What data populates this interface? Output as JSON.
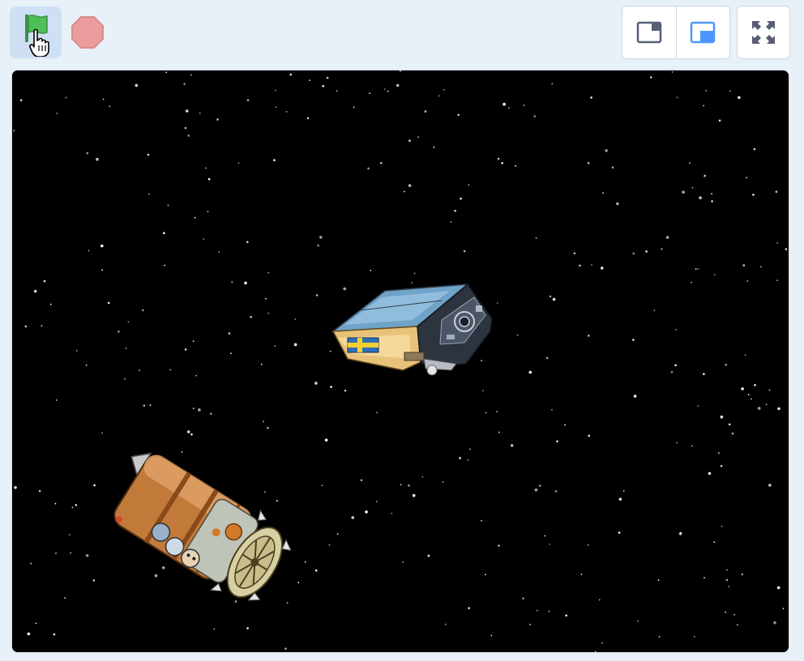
{
  "toolbar": {
    "green_flag": {
      "icon": "green-flag-icon",
      "color": "#4cbf56",
      "state": "hovered"
    },
    "stop": {
      "icon": "stop-icon",
      "color": "#ec9c9c"
    },
    "layout_modes": [
      {
        "icon": "small-stage-icon",
        "selected": false
      },
      {
        "icon": "large-stage-icon",
        "selected": true,
        "color": "#4c97ff"
      }
    ],
    "fullscreen": {
      "icon": "fullscreen-icon"
    }
  },
  "stage": {
    "background": "#000000",
    "backdrop": "starfield",
    "sprites": [
      {
        "name": "satellite",
        "flag": "Sweden"
      },
      {
        "name": "space-capsule"
      }
    ]
  },
  "colors": {
    "page_bg": "#e8f0f8",
    "border": "#cfd8e3",
    "accent": "#4c97ff"
  }
}
